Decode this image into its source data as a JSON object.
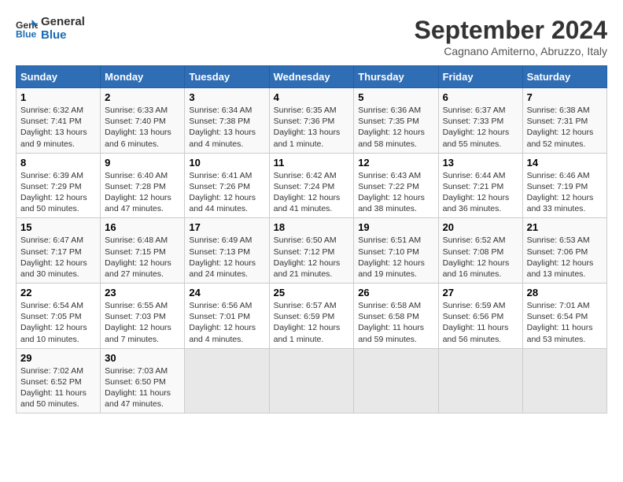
{
  "logo": {
    "line1": "General",
    "line2": "Blue"
  },
  "title": "September 2024",
  "location": "Cagnano Amiterno, Abruzzo, Italy",
  "days_of_week": [
    "Sunday",
    "Monday",
    "Tuesday",
    "Wednesday",
    "Thursday",
    "Friday",
    "Saturday"
  ],
  "weeks": [
    [
      {
        "day": 1,
        "info": "Sunrise: 6:32 AM\nSunset: 7:41 PM\nDaylight: 13 hours and 9 minutes."
      },
      {
        "day": 2,
        "info": "Sunrise: 6:33 AM\nSunset: 7:40 PM\nDaylight: 13 hours and 6 minutes."
      },
      {
        "day": 3,
        "info": "Sunrise: 6:34 AM\nSunset: 7:38 PM\nDaylight: 13 hours and 4 minutes."
      },
      {
        "day": 4,
        "info": "Sunrise: 6:35 AM\nSunset: 7:36 PM\nDaylight: 13 hours and 1 minute."
      },
      {
        "day": 5,
        "info": "Sunrise: 6:36 AM\nSunset: 7:35 PM\nDaylight: 12 hours and 58 minutes."
      },
      {
        "day": 6,
        "info": "Sunrise: 6:37 AM\nSunset: 7:33 PM\nDaylight: 12 hours and 55 minutes."
      },
      {
        "day": 7,
        "info": "Sunrise: 6:38 AM\nSunset: 7:31 PM\nDaylight: 12 hours and 52 minutes."
      }
    ],
    [
      {
        "day": 8,
        "info": "Sunrise: 6:39 AM\nSunset: 7:29 PM\nDaylight: 12 hours and 50 minutes."
      },
      {
        "day": 9,
        "info": "Sunrise: 6:40 AM\nSunset: 7:28 PM\nDaylight: 12 hours and 47 minutes."
      },
      {
        "day": 10,
        "info": "Sunrise: 6:41 AM\nSunset: 7:26 PM\nDaylight: 12 hours and 44 minutes."
      },
      {
        "day": 11,
        "info": "Sunrise: 6:42 AM\nSunset: 7:24 PM\nDaylight: 12 hours and 41 minutes."
      },
      {
        "day": 12,
        "info": "Sunrise: 6:43 AM\nSunset: 7:22 PM\nDaylight: 12 hours and 38 minutes."
      },
      {
        "day": 13,
        "info": "Sunrise: 6:44 AM\nSunset: 7:21 PM\nDaylight: 12 hours and 36 minutes."
      },
      {
        "day": 14,
        "info": "Sunrise: 6:46 AM\nSunset: 7:19 PM\nDaylight: 12 hours and 33 minutes."
      }
    ],
    [
      {
        "day": 15,
        "info": "Sunrise: 6:47 AM\nSunset: 7:17 PM\nDaylight: 12 hours and 30 minutes."
      },
      {
        "day": 16,
        "info": "Sunrise: 6:48 AM\nSunset: 7:15 PM\nDaylight: 12 hours and 27 minutes."
      },
      {
        "day": 17,
        "info": "Sunrise: 6:49 AM\nSunset: 7:13 PM\nDaylight: 12 hours and 24 minutes."
      },
      {
        "day": 18,
        "info": "Sunrise: 6:50 AM\nSunset: 7:12 PM\nDaylight: 12 hours and 21 minutes."
      },
      {
        "day": 19,
        "info": "Sunrise: 6:51 AM\nSunset: 7:10 PM\nDaylight: 12 hours and 19 minutes."
      },
      {
        "day": 20,
        "info": "Sunrise: 6:52 AM\nSunset: 7:08 PM\nDaylight: 12 hours and 16 minutes."
      },
      {
        "day": 21,
        "info": "Sunrise: 6:53 AM\nSunset: 7:06 PM\nDaylight: 12 hours and 13 minutes."
      }
    ],
    [
      {
        "day": 22,
        "info": "Sunrise: 6:54 AM\nSunset: 7:05 PM\nDaylight: 12 hours and 10 minutes."
      },
      {
        "day": 23,
        "info": "Sunrise: 6:55 AM\nSunset: 7:03 PM\nDaylight: 12 hours and 7 minutes."
      },
      {
        "day": 24,
        "info": "Sunrise: 6:56 AM\nSunset: 7:01 PM\nDaylight: 12 hours and 4 minutes."
      },
      {
        "day": 25,
        "info": "Sunrise: 6:57 AM\nSunset: 6:59 PM\nDaylight: 12 hours and 1 minute."
      },
      {
        "day": 26,
        "info": "Sunrise: 6:58 AM\nSunset: 6:58 PM\nDaylight: 11 hours and 59 minutes."
      },
      {
        "day": 27,
        "info": "Sunrise: 6:59 AM\nSunset: 6:56 PM\nDaylight: 11 hours and 56 minutes."
      },
      {
        "day": 28,
        "info": "Sunrise: 7:01 AM\nSunset: 6:54 PM\nDaylight: 11 hours and 53 minutes."
      }
    ],
    [
      {
        "day": 29,
        "info": "Sunrise: 7:02 AM\nSunset: 6:52 PM\nDaylight: 11 hours and 50 minutes."
      },
      {
        "day": 30,
        "info": "Sunrise: 7:03 AM\nSunset: 6:50 PM\nDaylight: 11 hours and 47 minutes."
      },
      null,
      null,
      null,
      null,
      null
    ]
  ]
}
